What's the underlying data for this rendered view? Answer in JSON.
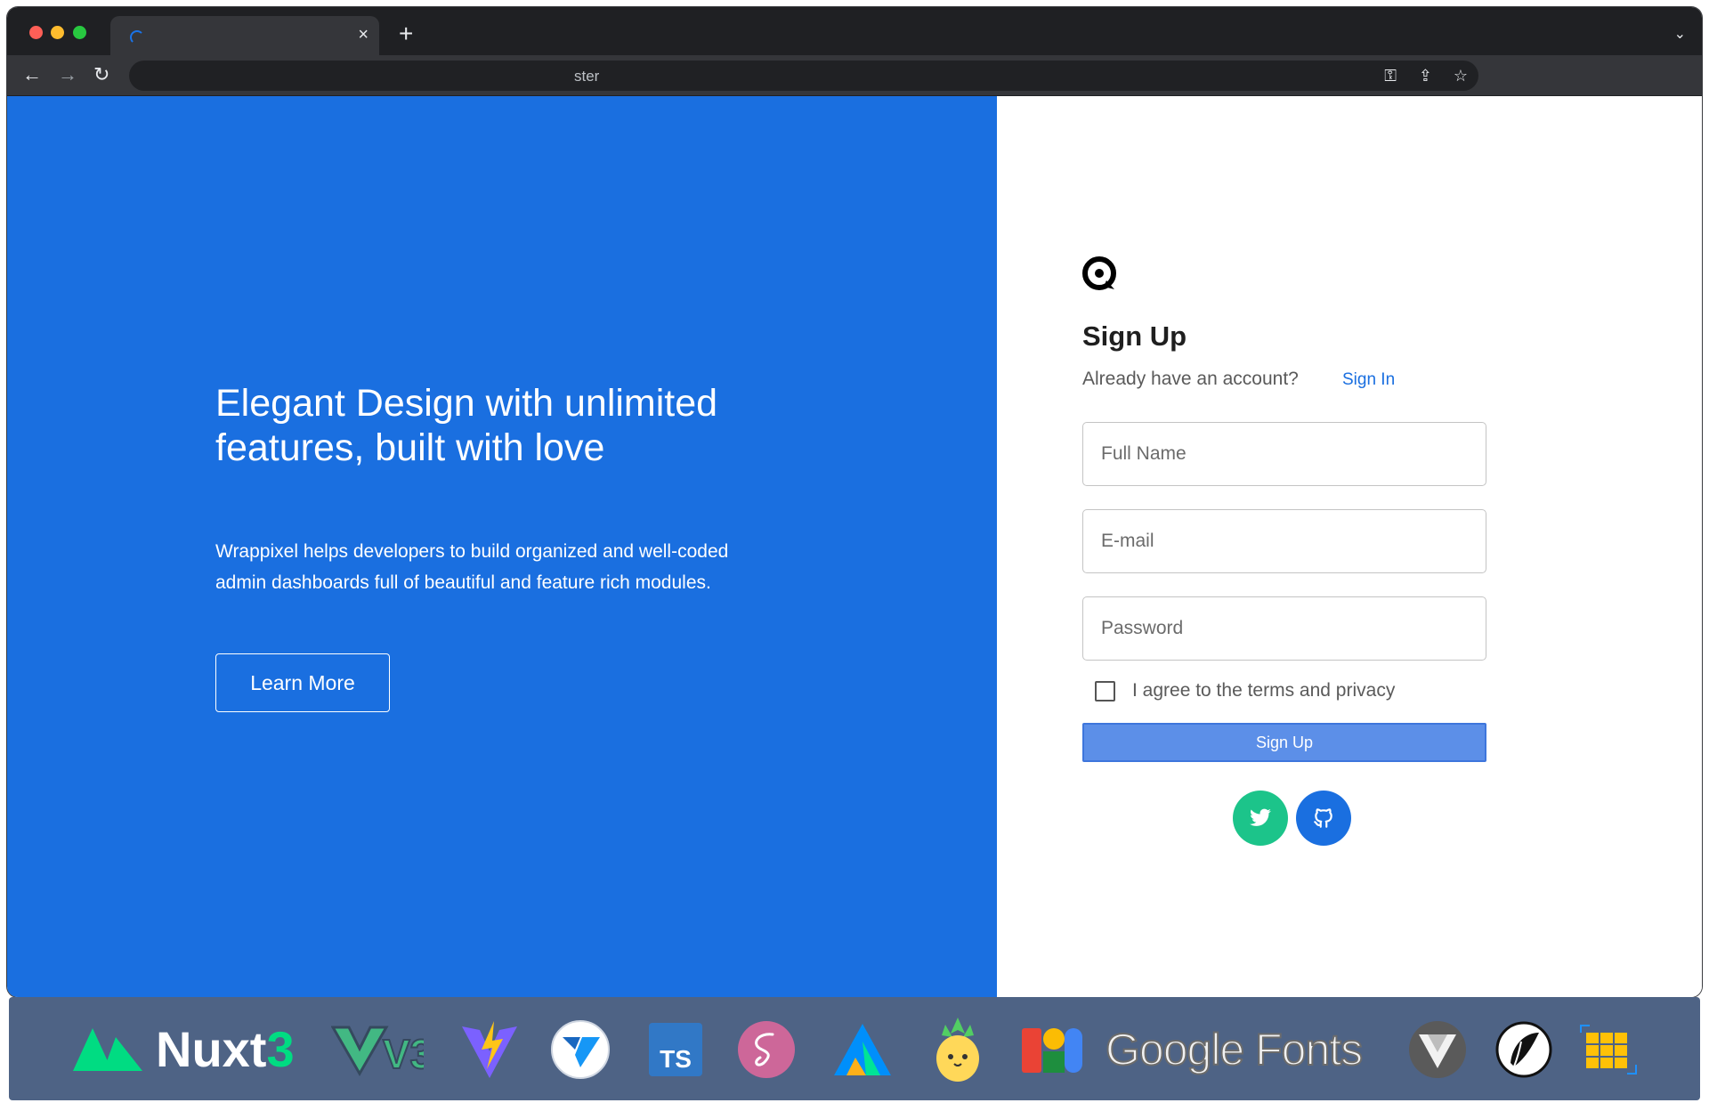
{
  "browser": {
    "tab_close": "×",
    "new_tab": "+",
    "tab_menu": "⌄",
    "url": "ster",
    "nav": {
      "back": "←",
      "forward": "→",
      "reload": "↻"
    },
    "omnibox_icons": {
      "key": "⚿",
      "share": "⇪",
      "star": "☆"
    }
  },
  "hero": {
    "title": "Elegant Design with unlimited features, built with love",
    "description": "Wrappixel helps developers to build organized and well-coded admin dashboards full of beautiful and feature rich modules.",
    "learn_more_label": "Learn More"
  },
  "signup": {
    "title": "Sign Up",
    "already_text": "Already have an account?",
    "signin_label": "Sign In",
    "full_name_placeholder": "Full Name",
    "email_placeholder": "E-mail",
    "password_placeholder": "Password",
    "agree_label": "I agree to the terms and privacy",
    "submit_label": "Sign Up",
    "agree_checked": false
  },
  "tech_strip": {
    "nuxt_name": "Nuxt",
    "nuxt_version": "3",
    "vue_label": "V3",
    "typescript_label": "TS",
    "google_fonts_label": "Google Fonts",
    "icons": [
      "nuxt-icon",
      "vue3-icon",
      "vite-icon",
      "vuetify-icon",
      "typescript-icon",
      "sass-icon",
      "apexcharts-icon",
      "pinia-icon",
      "material-icons-icon",
      "google-fonts-icon",
      "vueuse-icon",
      "tabler-icon",
      "datatable-icon"
    ]
  },
  "colors": {
    "hero_bg": "#1a6fe0",
    "signup_button": "#5c8fe8",
    "twitter": "#1cc48a",
    "github": "#1a6fe0",
    "tech_strip_bg": "#4e6385"
  }
}
